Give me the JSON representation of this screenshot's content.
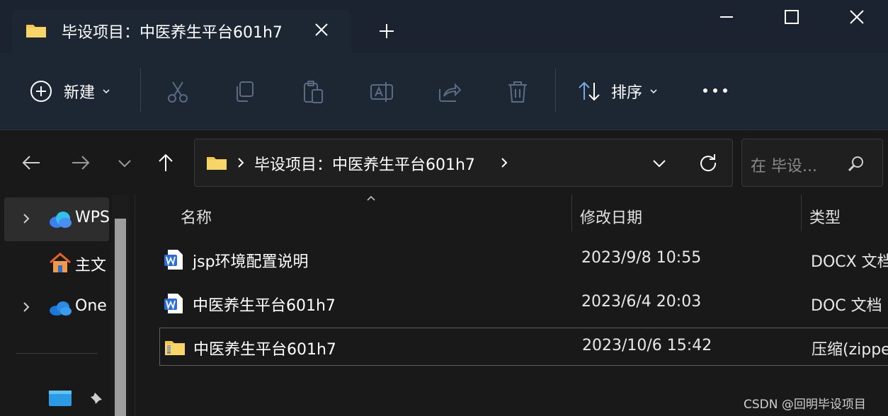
{
  "tab": {
    "title": "毕设项目：中医养生平台601h7"
  },
  "toolbar": {
    "new_label": "新建",
    "sort_label": "排序"
  },
  "address": {
    "path": "毕设项目：中医养生平台601h7",
    "search_placeholder": "在 毕设..."
  },
  "nav": {
    "items": [
      {
        "label": "WPS"
      },
      {
        "label": "主文"
      },
      {
        "label": "One"
      }
    ]
  },
  "columns": {
    "name": "名称",
    "modified": "修改日期",
    "type": "类型"
  },
  "files": [
    {
      "name": "jsp环境配置说明",
      "date": "2023/9/8 10:55",
      "type": "DOCX 文档"
    },
    {
      "name": "中医养生平台601h7",
      "date": "2023/6/4 20:03",
      "type": "DOC 文档"
    },
    {
      "name": "中医养生平台601h7",
      "date": "2023/10/6 15:42",
      "type": "压缩(zipped)"
    }
  ],
  "watermark": "CSDN @回明毕设项目",
  "colors": {
    "folder": "#f5c84a",
    "word": "#2b6fd6",
    "cloud": "#2b8be6"
  }
}
